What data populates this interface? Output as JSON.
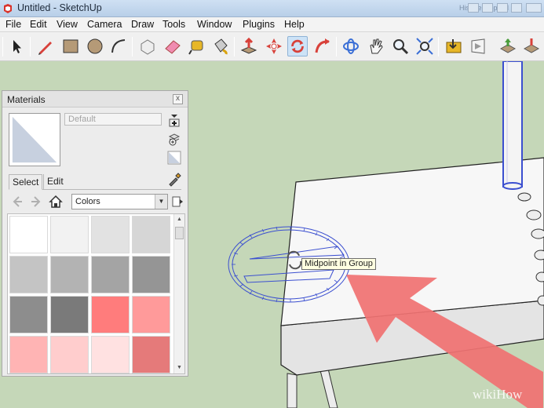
{
  "window": {
    "title": "Untitled - SketchUp",
    "ghost_title": "Hisarte Floppyd"
  },
  "menu": [
    "File",
    "Edit",
    "View",
    "Camera",
    "Draw",
    "Tools",
    "Window",
    "Plugins",
    "Help"
  ],
  "toolbar": [
    {
      "name": "select-tool",
      "icon": "arrow-cursor-icon"
    },
    {
      "name": "line-tool",
      "icon": "pencil-icon"
    },
    {
      "name": "rectangle-tool",
      "icon": "rectangle-icon"
    },
    {
      "name": "circle-tool",
      "icon": "circle-icon"
    },
    {
      "name": "arc-tool",
      "icon": "arc-icon"
    },
    {
      "name": "make-component-tool",
      "icon": "component-icon"
    },
    {
      "name": "eraser-tool",
      "icon": "eraser-icon"
    },
    {
      "name": "tape-measure-tool",
      "icon": "tape-measure-icon"
    },
    {
      "name": "paint-bucket-tool",
      "icon": "paint-bucket-icon"
    },
    {
      "name": "push-pull-tool",
      "icon": "push-pull-icon"
    },
    {
      "name": "move-tool",
      "icon": "move-icon"
    },
    {
      "name": "rotate-tool",
      "icon": "rotate-icon"
    },
    {
      "name": "follow-me-tool",
      "icon": "follow-me-icon"
    },
    {
      "name": "orbit-tool",
      "icon": "orbit-icon"
    },
    {
      "name": "pan-tool",
      "icon": "hand-icon"
    },
    {
      "name": "zoom-tool",
      "icon": "magnifier-icon"
    },
    {
      "name": "zoom-extents-tool",
      "icon": "zoom-extents-icon"
    },
    {
      "name": "previous-view-tool",
      "icon": "folder-icon"
    },
    {
      "name": "walk-tool",
      "icon": "walk-icon"
    },
    {
      "name": "get-models-tool",
      "icon": "warehouse-icon"
    },
    {
      "name": "share-model-tool",
      "icon": "share-icon"
    }
  ],
  "active_tool": "rotate-tool",
  "tooltip": "Midpoint in Group",
  "materials_panel": {
    "title": "Materials",
    "close_glyph": "x",
    "material_name": "Default",
    "tabs": [
      "Select",
      "Edit"
    ],
    "active_tab": "Select",
    "collection": "Colors",
    "swatches": [
      "#ffffff",
      "#f2f2f2",
      "#e2e2e2",
      "#d6d6d6",
      "#c4c4c4",
      "#b3b3b3",
      "#a4a4a4",
      "#959595",
      "#8d8d8d",
      "#7a7a7a",
      "#ff7c7c",
      "#ff9a9a",
      "#ffb4b4",
      "#ffcdcd",
      "#ffe1e1",
      "#e57a7a"
    ]
  },
  "watermark": "wikiHow",
  "colors": {
    "accent": "#3b5ec9",
    "arrow": "#f07070",
    "canvas": "#c5d7b8"
  }
}
